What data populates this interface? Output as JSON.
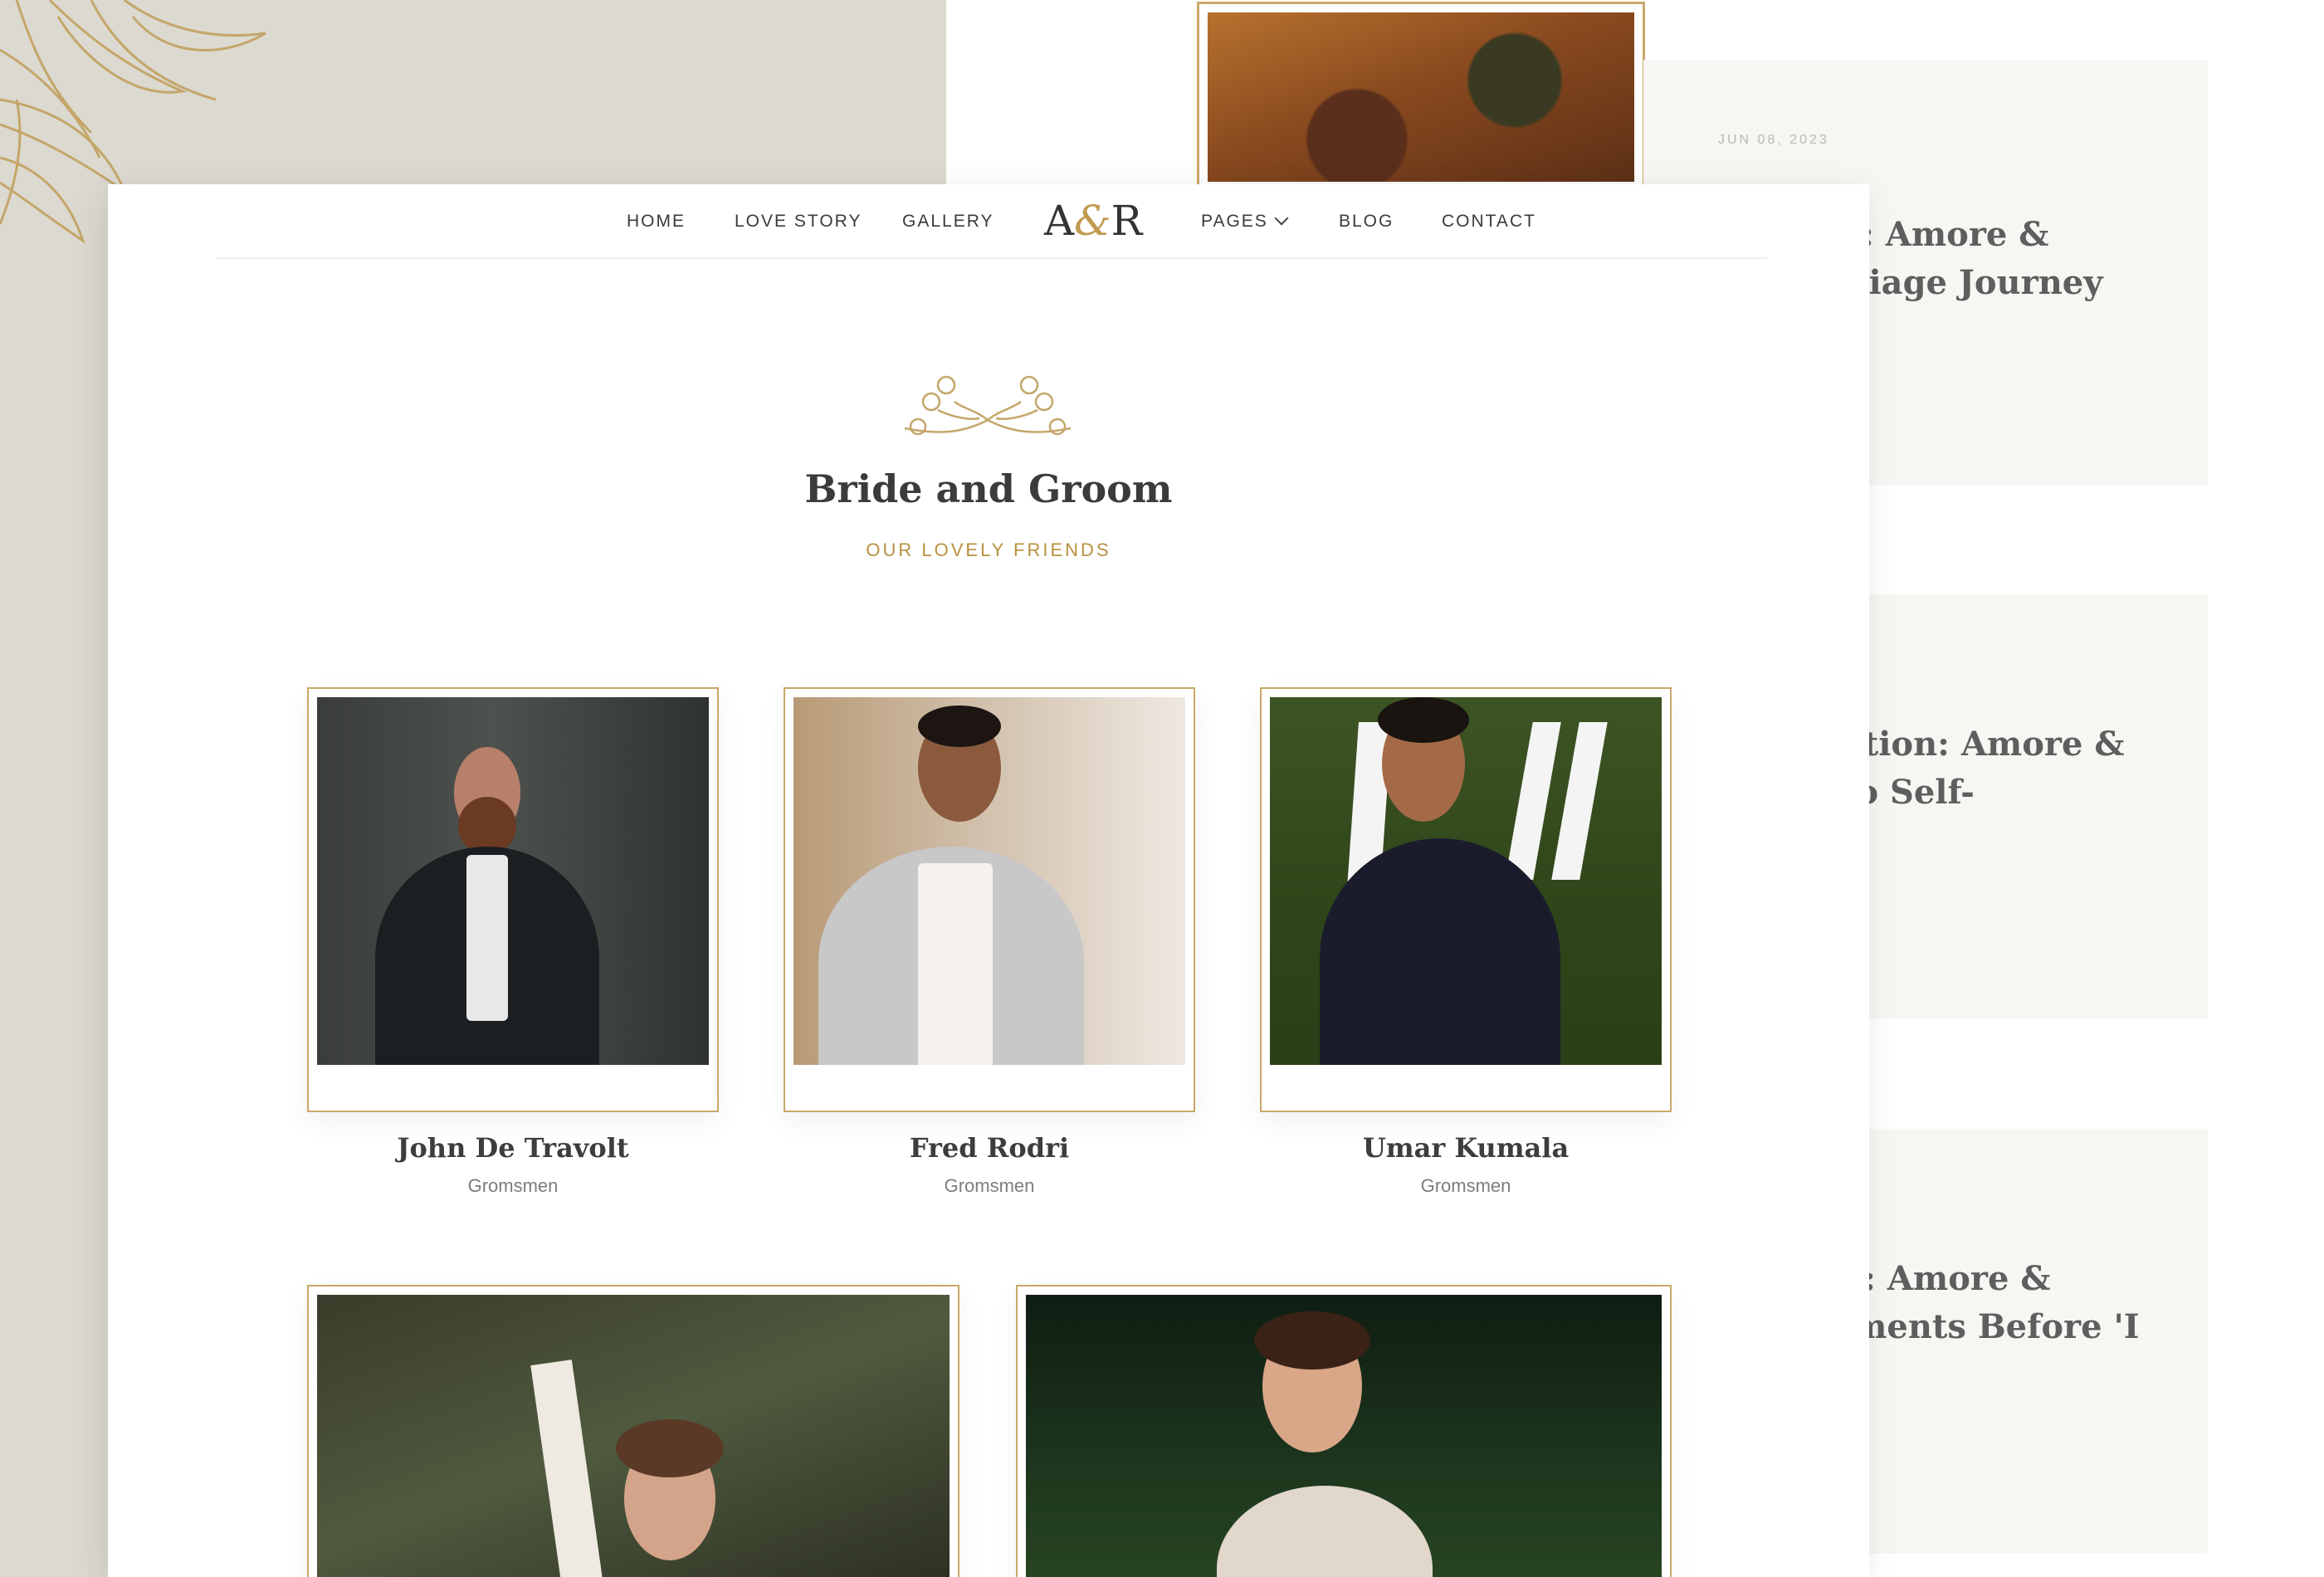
{
  "back_page": {
    "cards": [
      {
        "date": "JUN 08, 2023",
        "title": "mbrace: Amore &\nre-Marriage Journey"
      },
      {
        "title": "f Reflection: Amore &\nurney to Self-"
      },
      {
        "title": "Forever: Amore &\nnal Moments Before 'I"
      }
    ]
  },
  "nav": {
    "items_left": [
      "HOME",
      "LOVE STORY",
      "GALLERY"
    ],
    "logo": {
      "left": "A",
      "amp": "&",
      "right": "R"
    },
    "items_right": [
      "PAGES",
      "BLOG",
      "CONTACT"
    ]
  },
  "section": {
    "title": "Bride and Groom",
    "subtitle": "OUR LOVELY FRIENDS"
  },
  "people": [
    {
      "name": "John De Travolt",
      "role": "Gromsmen"
    },
    {
      "name": "Fred Rodri",
      "role": "Gromsmen"
    },
    {
      "name": "Umar Kumala",
      "role": "Gromsmen"
    }
  ],
  "colors": {
    "gold": "#c9a86a",
    "gold_text": "#b8913f",
    "background_beige": "#dcd9d0"
  },
  "icons": [
    "flower-line-art-icon",
    "floral-ornament-icon",
    "chevron-down-icon"
  ]
}
